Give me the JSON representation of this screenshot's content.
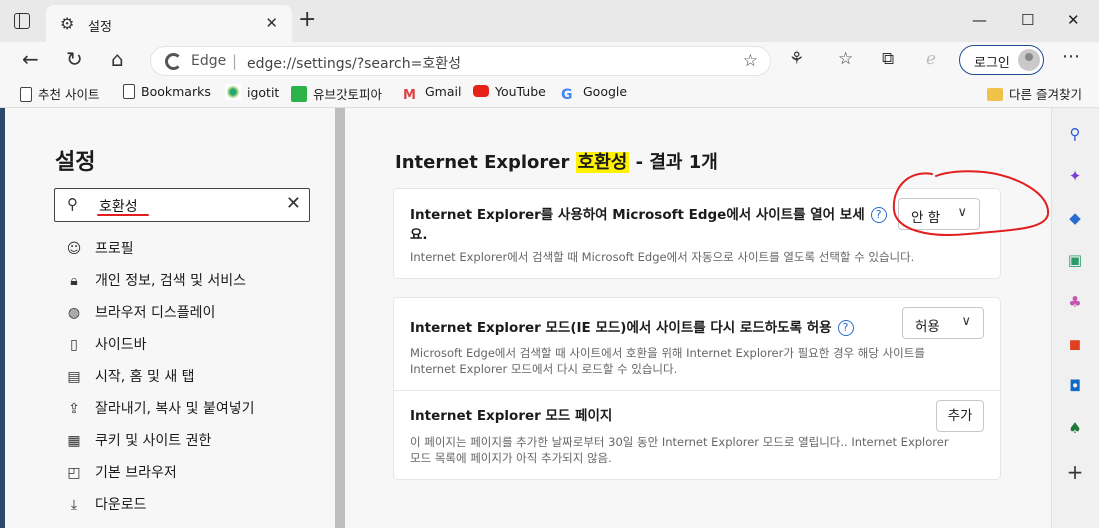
{
  "browser": {
    "tab_title": "설정",
    "omnibox_brand": "Edge",
    "url": "edge://settings/?search=호환성",
    "login_label": "로그인"
  },
  "favorites": [
    {
      "label": "추천 사이트",
      "icon": "document-icon"
    },
    {
      "label": "Bookmarks",
      "icon": "document-icon"
    },
    {
      "label": "igotit",
      "icon": "igotit-icon"
    },
    {
      "label": "유브갓토피아",
      "icon": "ubigot-icon"
    },
    {
      "label": "Gmail",
      "icon": "gmail-icon"
    },
    {
      "label": "YouTube",
      "icon": "youtube-icon"
    },
    {
      "label": "Google",
      "icon": "google-icon"
    }
  ],
  "other_favorites": "다른 즐겨찾기",
  "sidebar": {
    "title": "설정",
    "search_value": "호환성",
    "items": [
      {
        "label": "프로필",
        "icon": "profile-icon"
      },
      {
        "label": "개인 정보, 검색 및 서비스",
        "icon": "lock-icon"
      },
      {
        "label": "브라우저 디스플레이",
        "icon": "palette-icon"
      },
      {
        "label": "사이드바",
        "icon": "sidebar-icon"
      },
      {
        "label": "시작, 홈 및 새 탭",
        "icon": "home-tab-icon"
      },
      {
        "label": "잘라내기, 복사 및 붙여넣기",
        "icon": "share-icon"
      },
      {
        "label": "쿠키 및 사이트 권한",
        "icon": "cookie-icon"
      },
      {
        "label": "기본 브라우저",
        "icon": "browser-icon"
      },
      {
        "label": "다운로드",
        "icon": "download-icon"
      }
    ]
  },
  "main": {
    "title_prefix": "Internet Explorer ",
    "title_highlight": "호환성",
    "title_suffix": " - 결과 1개",
    "card1": {
      "title_line1": "Internet Explorer를 사용하여 Microsoft Edge에서 사이트를 열어 보세",
      "title_line2": "요.",
      "desc": "Internet Explorer에서 검색할 때 Microsoft Edge에서 자동으로 사이트를 열도록 선택할 수 있습니다.",
      "dropdown_value": "안 함"
    },
    "card2": {
      "setting1": {
        "title": "Internet Explorer 모드(IE 모드)에서 사이트를 다시 로드하도록 허용",
        "desc_line1": "Microsoft Edge에서 검색할 때 사이트에서 호환을 위해 Internet Explorer가 필요한 경우 해당 사이트를",
        "desc_line2": "Internet Explorer 모드에서 다시 로드할 수 있습니다.",
        "dropdown_value": "허용"
      },
      "setting2": {
        "title": "Internet Explorer 모드 페이지",
        "desc_line1": "이 페이지는 페이지를 추가한 날짜로부터 30일 동안 Internet Explorer 모드로 열립니다.. Internet Explorer",
        "desc_line2": "모드 목록에 페이지가 아직 추가되지 않음.",
        "button_label": "추가"
      }
    }
  },
  "annotation_color": "#e21f1f",
  "highlight_color": "#fff200",
  "accent_color": "#1f4c8f"
}
